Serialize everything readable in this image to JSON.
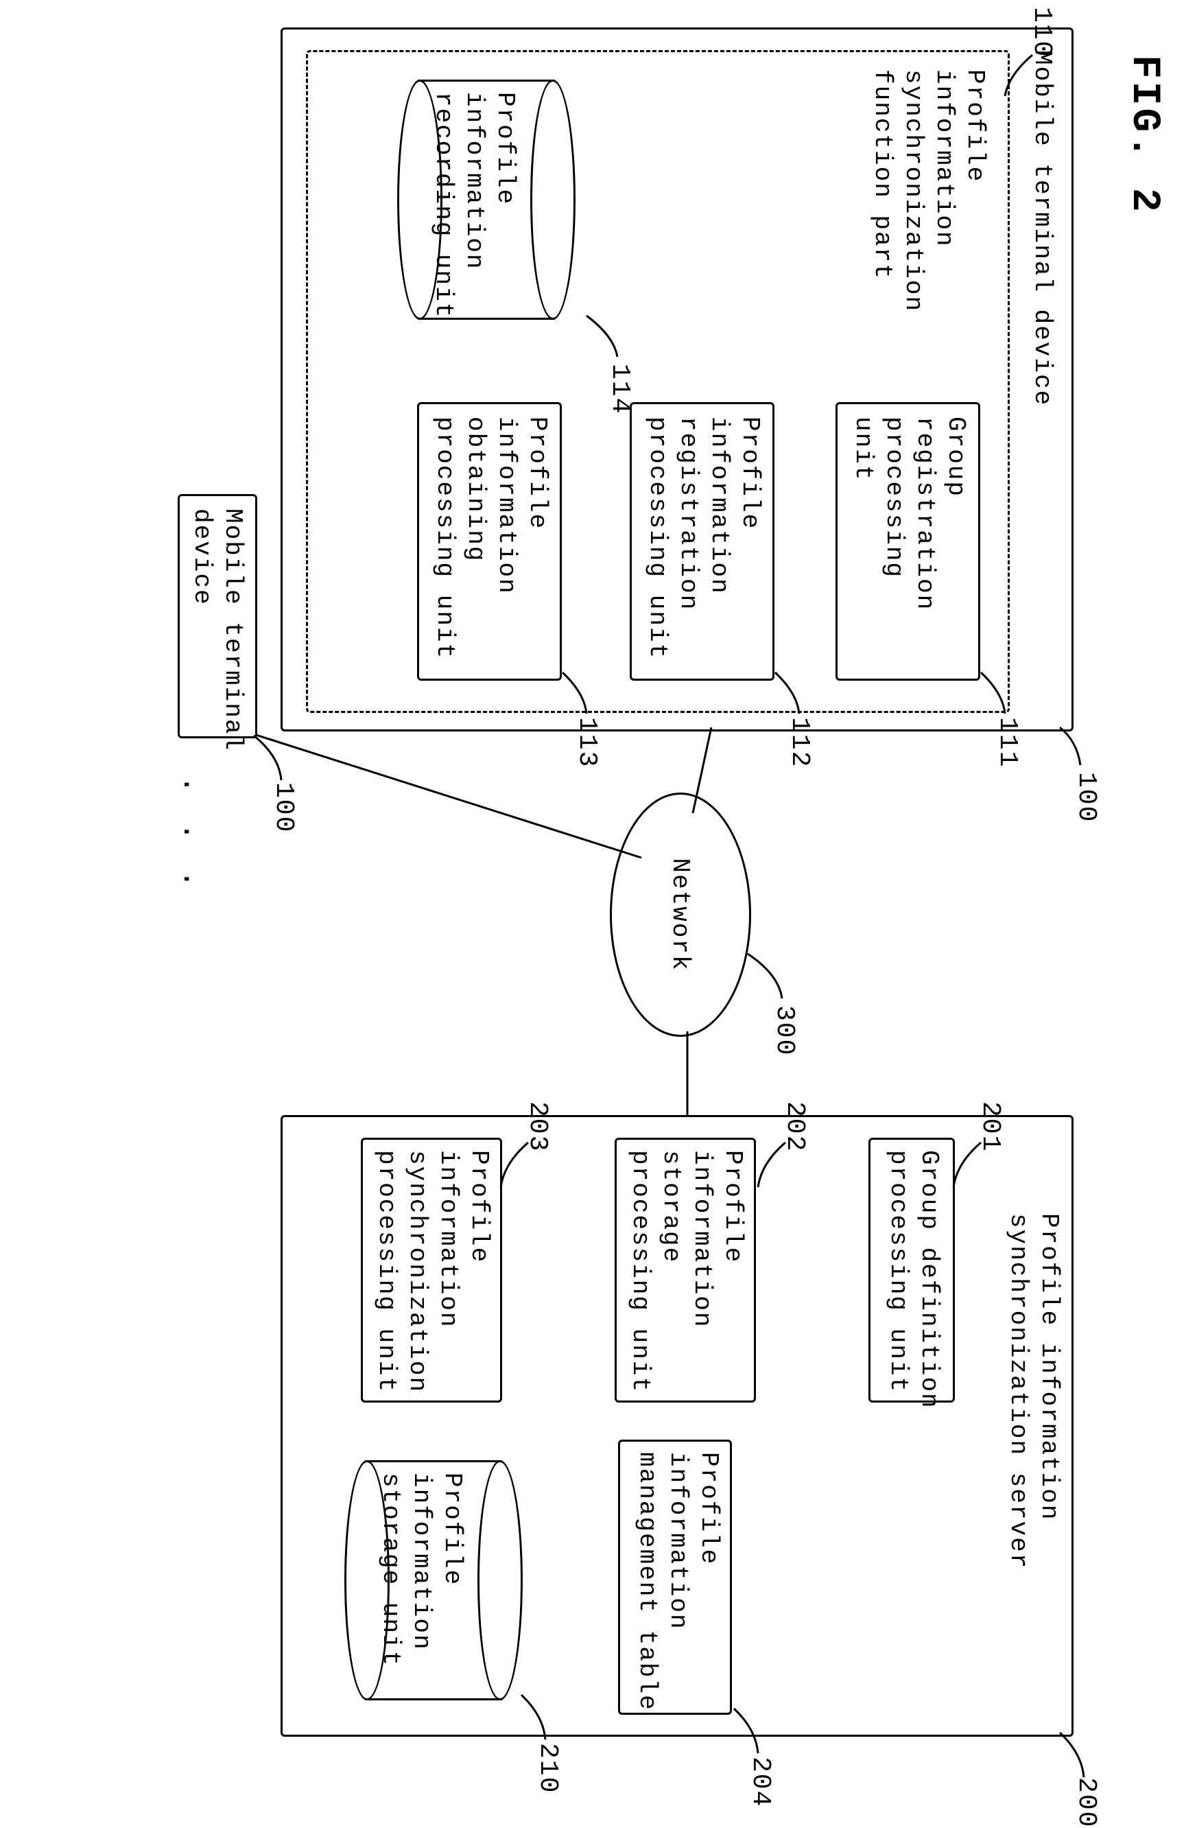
{
  "figure_title": "FIG. 2",
  "mobile_terminal": {
    "ref": "100",
    "title": "Mobile terminal device",
    "sync_part": {
      "ref": "110",
      "title": "Profile\ninformation\nsynchronization\nfunction part",
      "units": {
        "group_reg": {
          "ref": "111",
          "label": "Group\nregistration\nprocessing\nunit"
        },
        "profile_reg": {
          "ref": "112",
          "label": "Profile\ninformation\nregistration\nprocessing unit"
        },
        "profile_obtain": {
          "ref": "113",
          "label": "Profile\ninformation\nobtaining\nprocessing unit"
        },
        "recording": {
          "ref": "114",
          "label": "Profile\ninformation\nrecording unit"
        }
      }
    }
  },
  "mobile_terminal_other": {
    "ref": "100",
    "title": "Mobile terminal\ndevice"
  },
  "network": {
    "ref": "300",
    "label": "Network"
  },
  "server": {
    "ref": "200",
    "title": "Profile information\nsynchronization server",
    "units": {
      "group_def": {
        "ref": "201",
        "label": "Group definition\nprocessing unit"
      },
      "storage_proc": {
        "ref": "202",
        "label": "Profile\ninformation\nstorage\nprocessing unit"
      },
      "sync_proc": {
        "ref": "203",
        "label": "Profile\ninformation\nsynchronization\nprocessing unit"
      },
      "mgmt_table": {
        "ref": "204",
        "label": "Profile\ninformation\nmanagement table"
      },
      "storage_unit": {
        "ref": "210",
        "label": "Profile\ninformation\nstorage unit"
      }
    }
  },
  "ellipsis": ". . ."
}
